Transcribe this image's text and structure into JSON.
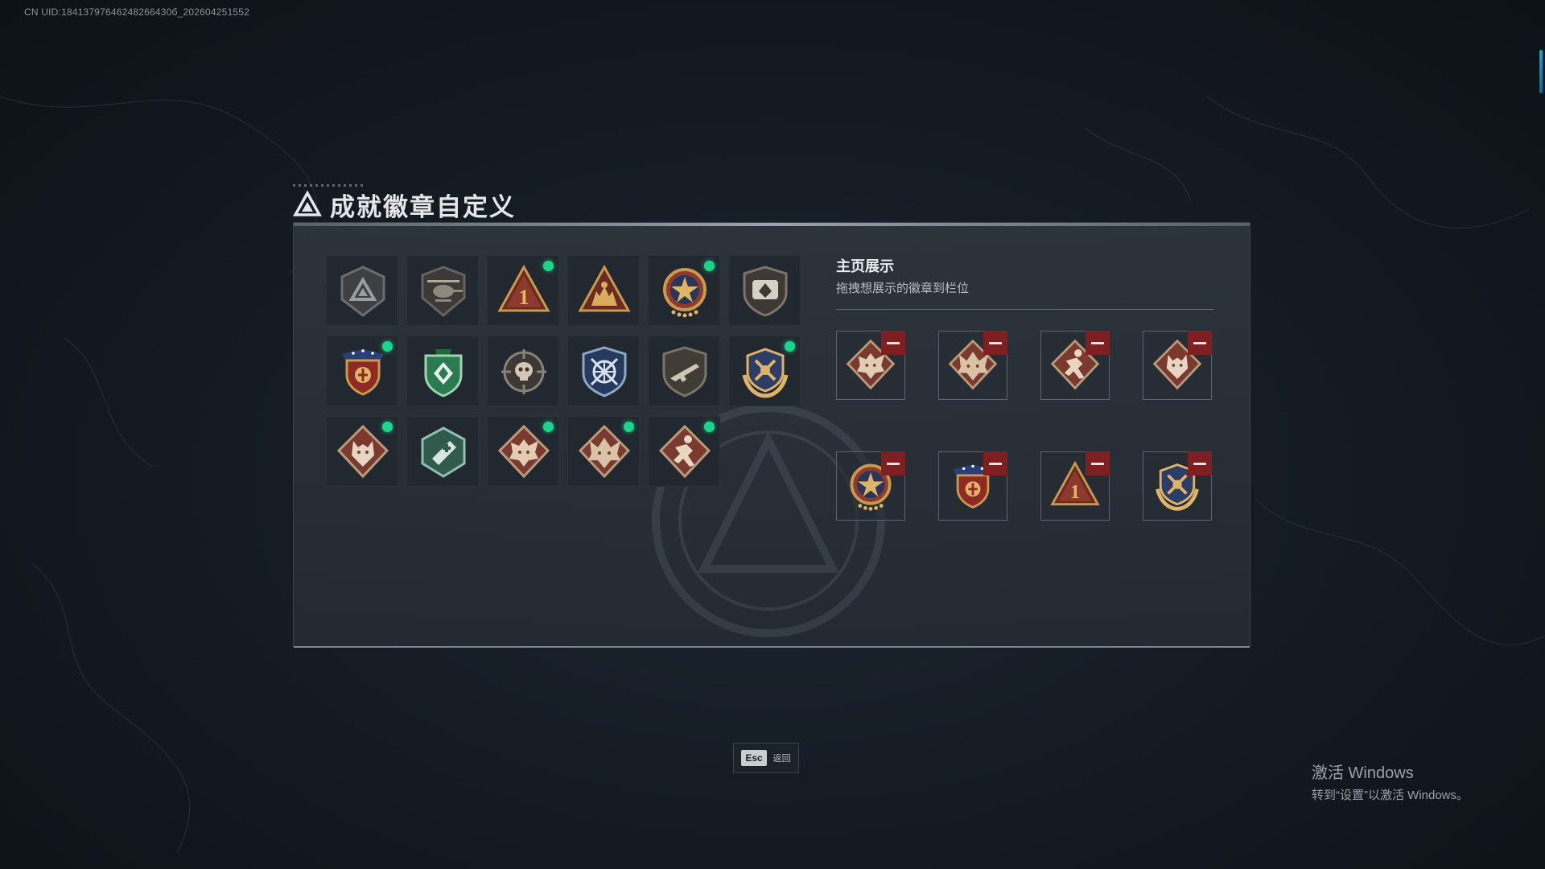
{
  "uid_text": "CN UID:18413797646248266430б_202604251552",
  "title": "成就徽章自定义",
  "colors": {
    "accent_green": "#19d78a",
    "remove_red": "#7e2022",
    "gold": "#c99a4a",
    "bronze": "#8c4a3a"
  },
  "collection": {
    "badges": [
      {
        "name": "tactical-triangle-badge-icon",
        "new": false
      },
      {
        "name": "helicopter-badge-icon",
        "new": false
      },
      {
        "name": "number-one-triangle-badge-icon",
        "new": true
      },
      {
        "name": "soldiers-triangle-badge-icon",
        "new": false
      },
      {
        "name": "star-medal-badge-icon",
        "new": true
      },
      {
        "name": "shield-emblem-badge-icon",
        "new": false
      },
      {
        "name": "ribbon-shield-badge-icon",
        "new": true
      },
      {
        "name": "green-diamond-shield-badge-icon",
        "new": false
      },
      {
        "name": "skull-crosshair-badge-icon",
        "new": false
      },
      {
        "name": "crossed-blades-blue-shield-badge-icon",
        "new": false
      },
      {
        "name": "rifle-shield-badge-icon",
        "new": false
      },
      {
        "name": "gold-laurel-shield-badge-icon",
        "new": true
      },
      {
        "name": "wolf-head-badge-icon",
        "new": true
      },
      {
        "name": "medkit-hexagon-badge-icon",
        "new": false
      },
      {
        "name": "dragon-head-badge-icon",
        "new": true
      },
      {
        "name": "dragon-head-alt-badge-icon",
        "new": true
      },
      {
        "name": "runner-badge-icon",
        "new": true
      }
    ]
  },
  "showcase": {
    "title": "主页展示",
    "subtitle": "拖拽想展示的徽章到栏位",
    "slots": [
      {
        "name": "dragon-head-badge-icon"
      },
      {
        "name": "dragon-head-alt-badge-icon"
      },
      {
        "name": "runner-badge-icon"
      },
      {
        "name": "wolf-head-badge-icon"
      },
      {
        "name": "star-medal-badge-icon"
      },
      {
        "name": "ribbon-shield-badge-icon"
      },
      {
        "name": "number-one-triangle-badge-icon"
      },
      {
        "name": "gold-laurel-shield-badge-icon"
      }
    ]
  },
  "footer": {
    "esc_key": "Esc",
    "esc_label": "返回"
  },
  "windows_activation": {
    "line1": "激活 Windows",
    "line2": "转到“设置”以激活 Windows。"
  }
}
